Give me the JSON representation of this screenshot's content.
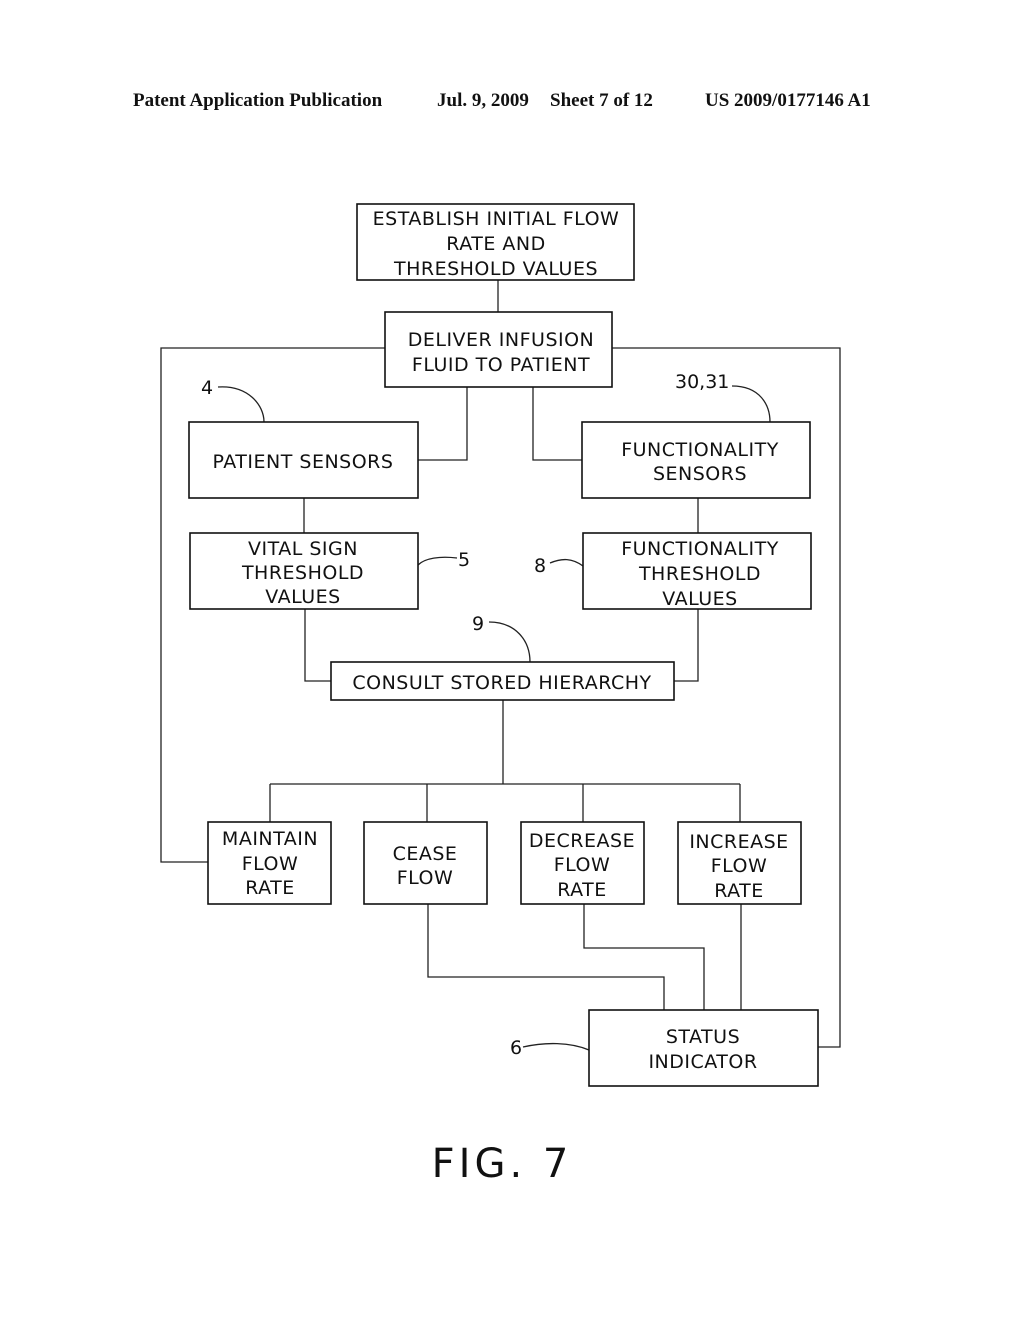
{
  "header": {
    "publication": "Patent Application Publication",
    "date": "Jul. 9, 2009",
    "sheet": "Sheet 7 of 12",
    "number": "US 2009/0177146 A1"
  },
  "boxes": {
    "establish": [
      "ESTABLISH INITIAL FLOW",
      "RATE AND",
      "THRESHOLD VALUES"
    ],
    "deliver": [
      "DELIVER INFUSION",
      "FLUID TO PATIENT"
    ],
    "patient_sensors": [
      "PATIENT SENSORS"
    ],
    "functionality_sensors": [
      "FUNCTIONALITY",
      "SENSORS"
    ],
    "vital_sign": [
      "VITAL SIGN",
      "THRESHOLD",
      "VALUES"
    ],
    "functionality_threshold": [
      "FUNCTIONALITY",
      "THRESHOLD",
      "VALUES"
    ],
    "consult": [
      "CONSULT STORED HIERARCHY"
    ],
    "maintain": [
      "MAINTAIN",
      "FLOW",
      "RATE"
    ],
    "cease": [
      "CEASE",
      "FLOW"
    ],
    "decrease": [
      "DECREASE",
      "FLOW",
      "RATE"
    ],
    "increase": [
      "INCREASE",
      "FLOW",
      "RATE"
    ],
    "status": [
      "STATUS",
      "INDICATOR"
    ]
  },
  "refs": {
    "patient_sensors": "4",
    "functionality_sensors": "30,31",
    "vital_sign": "5",
    "functionality_threshold": "8",
    "consult": "9",
    "status": "6"
  },
  "figure_label": "FIG. 7"
}
